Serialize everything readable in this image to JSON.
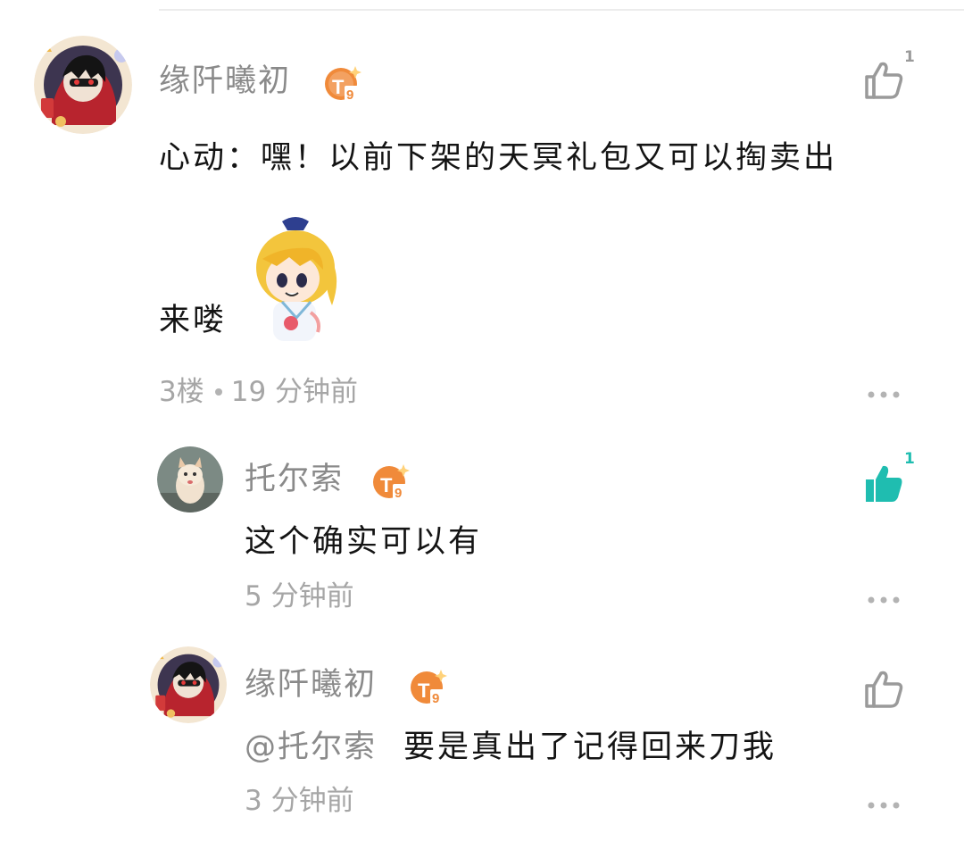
{
  "colors": {
    "accent": "#1fbdb0",
    "muted": "#8a8a8a",
    "badge": "#f08a3a"
  },
  "comments": [
    {
      "username": "缘阡曦初",
      "badge": "T9",
      "text_line1": "心动：嘿！以前下架的天冥礼包又可以掏卖出",
      "text_line2": "来喽",
      "sticker": "anime-girl-sticker",
      "floor": "3楼",
      "time": "19 分钟前",
      "like_count": "1",
      "liked": false
    }
  ],
  "replies": [
    {
      "username": "托尔索",
      "badge": "T9",
      "text": "这个确实可以有",
      "time": "5 分钟前",
      "like_count": "1",
      "liked": true
    },
    {
      "username": "缘阡曦初",
      "badge": "T9",
      "mention": "@托尔索",
      "text": "要是真出了记得回来刀我",
      "time": "3 分钟前",
      "like_count": "",
      "liked": false
    }
  ]
}
